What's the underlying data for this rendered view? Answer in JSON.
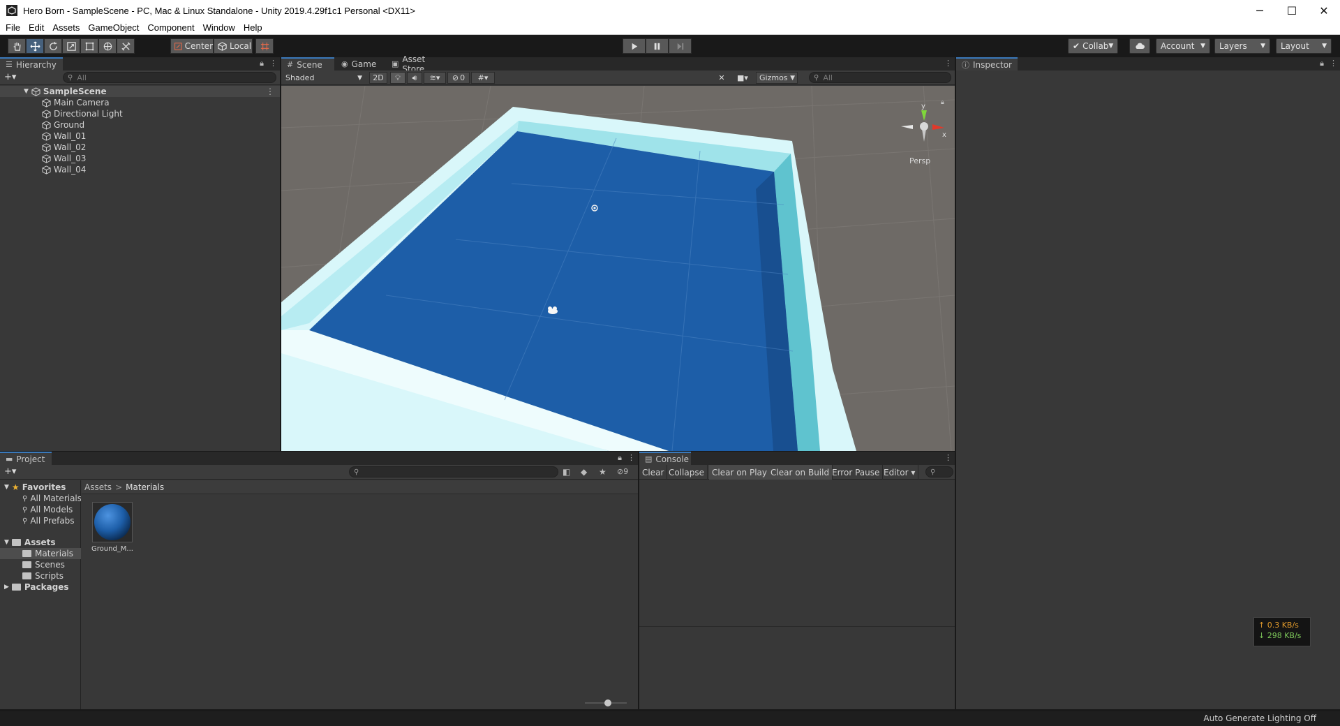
{
  "window": {
    "title": "Hero Born - SampleScene - PC, Mac & Linux Standalone - Unity 2019.4.29f1c1 Personal <DX11>",
    "controls": [
      "─",
      "☐",
      "✕"
    ]
  },
  "menu": [
    "File",
    "Edit",
    "Assets",
    "GameObject",
    "Component",
    "Window",
    "Help"
  ],
  "toolbar": {
    "pivot_center": "Center",
    "pivot_local": "Local",
    "collab": "Collab",
    "account": "Account",
    "layers": "Layers",
    "layout": "Layout",
    "active_tool": "move"
  },
  "hierarchy": {
    "tab": "Hierarchy",
    "add": "+▾",
    "search_placeholder": "All",
    "scene": "SampleScene",
    "items": [
      "Main Camera",
      "Directional Light",
      "Ground",
      "Wall_01",
      "Wall_02",
      "Wall_03",
      "Wall_04"
    ]
  },
  "scene_view": {
    "tabs": [
      "Scene",
      "Game",
      "Asset Store"
    ],
    "shading_mode": "Shaded",
    "mode_2d": "2D",
    "hidden_count": "0",
    "gizmos": "Gizmos",
    "search_placeholder": "All",
    "projection": "Persp",
    "axis_labels": {
      "x": "x",
      "y": "y"
    }
  },
  "inspector": {
    "tab": "Inspector"
  },
  "project": {
    "tab": "Project",
    "add": "+▾",
    "hidden_packages_count": "9",
    "favorites_label": "Favorites",
    "favorites": [
      "All Materials",
      "All Models",
      "All Prefabs"
    ],
    "assets_label": "Assets",
    "asset_folders": [
      "Materials",
      "Scenes",
      "Scripts"
    ],
    "packages_label": "Packages",
    "breadcrumb": [
      "Assets",
      "Materials"
    ],
    "breadcrumb_sep": ">",
    "files": [
      {
        "name": "Ground_M...",
        "color": "#1d5ea8"
      }
    ]
  },
  "console": {
    "tab": "Console",
    "buttons": [
      "Clear",
      "Collapse",
      "Clear on Play",
      "Clear on Build",
      "Error Pause",
      "Editor ▾"
    ]
  },
  "network": {
    "up": "↑ 0.3 KB/s",
    "down": "↓ 298 KB/s",
    "up_color": "#e09a2c",
    "down_color": "#7ec85a"
  },
  "status": {
    "lighting": "Auto Generate Lighting Off"
  },
  "colors": {
    "accent": "#3a79bb",
    "ground": "#1d5ea8",
    "wall": "#bdeef3",
    "viewport_bg": "#6e6a66"
  }
}
